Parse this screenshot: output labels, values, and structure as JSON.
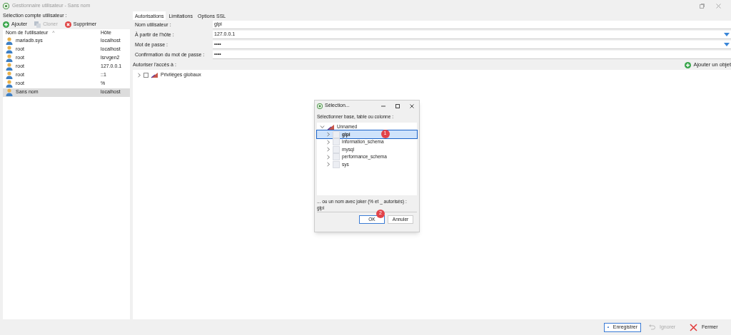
{
  "window": {
    "title": "Gestionnaire utilisateur - Sans nom"
  },
  "left": {
    "label": "Sélection compte utilisateur :",
    "toolbar": [
      {
        "kind": "add",
        "label": "Ajouter",
        "disabled": false
      },
      {
        "kind": "clone",
        "label": "Cloner",
        "disabled": true
      },
      {
        "kind": "delete",
        "label": "Supprimer",
        "disabled": false
      }
    ],
    "columns": [
      "Nom de l'utilisateur",
      "Hôte"
    ],
    "sort_icon": "^",
    "rows": [
      {
        "name": "mariadb.sys",
        "host": "localhost",
        "selected": false
      },
      {
        "name": "root",
        "host": "localhost",
        "selected": false
      },
      {
        "name": "root",
        "host": "lsrvgen2",
        "selected": false
      },
      {
        "name": "root",
        "host": "127.0.0.1",
        "selected": false
      },
      {
        "name": "root",
        "host": "::1",
        "selected": false
      },
      {
        "name": "root",
        "host": "%",
        "selected": false
      },
      {
        "name": "Sans nom",
        "host": "localhost",
        "selected": true
      }
    ]
  },
  "tabs": [
    {
      "label": "Autorisations",
      "selected": true
    },
    {
      "label": "Limitations",
      "selected": false
    },
    {
      "label": "Options SSL",
      "selected": false
    }
  ],
  "fields": [
    {
      "label": "Nom utilisateur :",
      "value": "glpi",
      "kind": "text"
    },
    {
      "label": "À partir de l'hôte :",
      "value": "127.0.0.1",
      "kind": "dropdown"
    },
    {
      "label": "Mot de passe :",
      "value": "••••",
      "kind": "dropdown"
    },
    {
      "label": "Confirmation du mot de passe :",
      "value": "••••",
      "kind": "text"
    }
  ],
  "access": {
    "label": "Autoriser l'accès à :",
    "add_label": "Ajouter un objet",
    "tree": [
      {
        "label": "Privilèges globaux",
        "checked": false,
        "expanded": false
      }
    ]
  },
  "dialog": {
    "title": "Sélection...",
    "prompt": "Sélectionner base, table ou colonne :",
    "tree": [
      {
        "label": "Unnamed",
        "expanded": true,
        "children": [
          {
            "label": "glpi",
            "selected": true,
            "badge": "1"
          },
          {
            "label": "information_schema",
            "selected": false
          },
          {
            "label": "mysql",
            "selected": false
          },
          {
            "label": "performance_schema",
            "selected": false
          },
          {
            "label": "sys",
            "selected": false
          }
        ]
      }
    ],
    "wildcard_label": "... ou un nom avec joker (% et _ autorisés) :",
    "wildcard_value": "glpi",
    "buttons": [
      {
        "label": "OK",
        "badge": "2",
        "kind": "default"
      },
      {
        "label": "Annuler",
        "kind": "normal"
      }
    ]
  },
  "footer": [
    {
      "kind": "save",
      "label": "Enregistrer",
      "disabled": false
    },
    {
      "kind": "undo",
      "label": "Ignorer",
      "disabled": true
    },
    {
      "kind": "close",
      "label": "Fermer",
      "disabled": false
    }
  ]
}
